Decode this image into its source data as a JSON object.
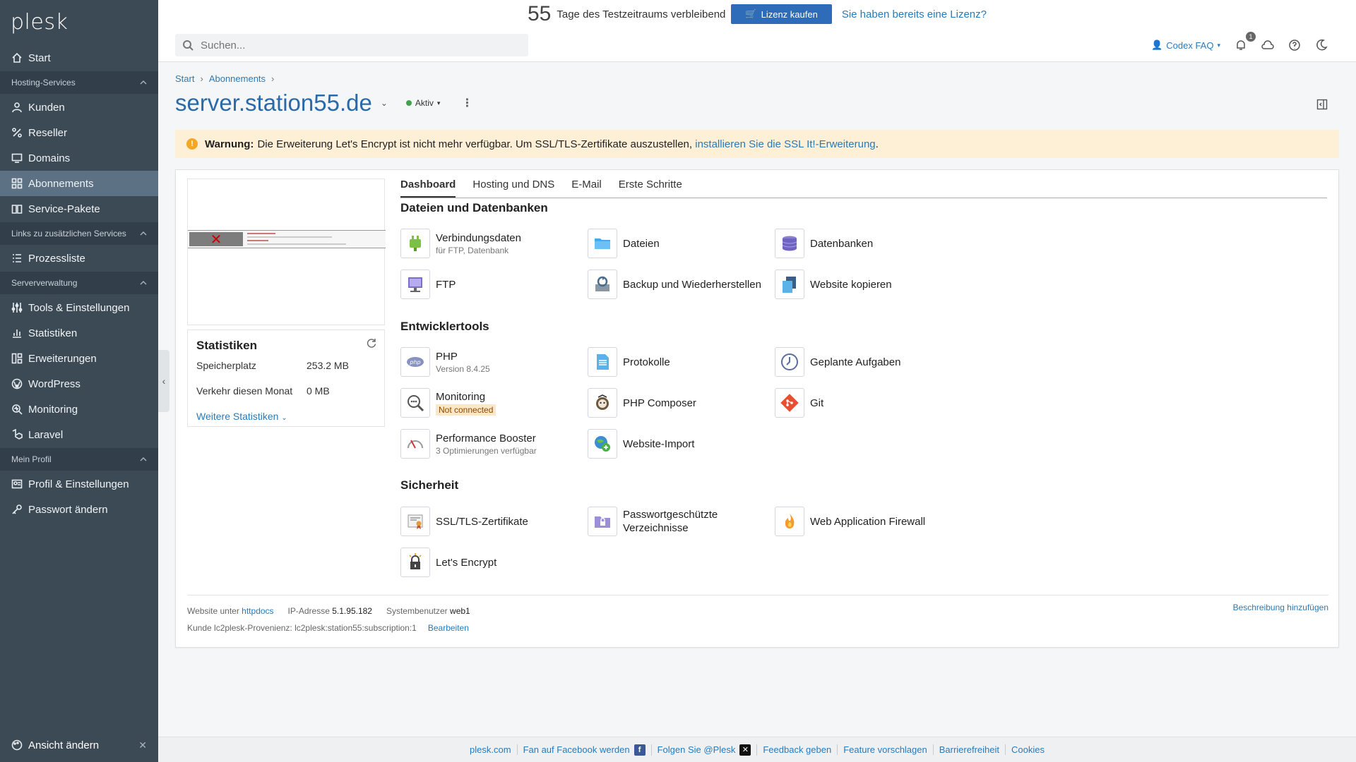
{
  "sidebar": {
    "logo": "plesk",
    "start": "Start",
    "group_hosting": "Hosting-Services",
    "kunden": "Kunden",
    "reseller": "Reseller",
    "domains": "Domains",
    "abonnements": "Abonnements",
    "service_pakete": "Service-Pakete",
    "group_links": "Links zu zusätzlichen Services",
    "prozessliste": "Prozessliste",
    "group_server": "Serververwaltung",
    "tools": "Tools & Einstellungen",
    "statistiken": "Statistiken",
    "erweiterungen": "Erweiterungen",
    "wordpress": "WordPress",
    "monitoring": "Monitoring",
    "laravel": "Laravel",
    "group_profil": "Mein Profil",
    "profil": "Profil & Einstellungen",
    "passwort": "Passwort ändern",
    "ansicht": "Ansicht ändern"
  },
  "trial": {
    "count": "55",
    "text": "Tage des Testzeitraums verbleibend",
    "buy": "Lizenz kaufen",
    "have": "Sie haben bereits eine Lizenz?"
  },
  "header": {
    "search_placeholder": "Suchen...",
    "user": "Codex FAQ",
    "notifications": "1"
  },
  "breadcrumb": {
    "start": "Start",
    "abonnements": "Abonnements"
  },
  "page": {
    "title": "server.station55.de",
    "status": "Aktiv"
  },
  "warning": {
    "label": "Warnung:",
    "text": "Die Erweiterung Let's Encrypt ist nicht mehr verfügbar. Um SSL/TLS-Zertifikate auszustellen,",
    "link": "installieren Sie die SSL It!-Erweiterung",
    "end": "."
  },
  "stats": {
    "title": "Statistiken",
    "disk_label": "Speicherplatz",
    "disk_value": "253.2 MB",
    "traffic_label": "Verkehr diesen Monat",
    "traffic_value": "0 MB",
    "more": "Weitere Statistiken"
  },
  "tabs": [
    "Dashboard",
    "Hosting und DNS",
    "E-Mail",
    "Erste Schritte"
  ],
  "sections": {
    "files": "Dateien und Datenbanken",
    "dev": "Entwicklertools",
    "security": "Sicherheit"
  },
  "tiles": {
    "verbindung": "Verbindungsdaten",
    "verbindung_sub": "für FTP, Datenbank",
    "dateien": "Dateien",
    "datenbanken": "Datenbanken",
    "ftp": "FTP",
    "backup": "Backup und Wiederherstellen",
    "kopieren": "Website kopieren",
    "php": "PHP",
    "php_sub": "Version 8.4.25",
    "protokolle": "Protokolle",
    "geplant": "Geplante Aufgaben",
    "monitoring": "Monitoring",
    "monitoring_badge": "Not connected",
    "composer": "PHP Composer",
    "git": "Git",
    "booster": "Performance Booster",
    "booster_sub": "3 Optimierungen verfügbar",
    "import": "Website-Import",
    "ssl": "SSL/TLS-Zertifikate",
    "pw1": "Passwortgeschützte",
    "pw2": "Verzeichnisse",
    "waf": "Web Application Firewall",
    "letsencrypt": "Let's Encrypt"
  },
  "cardfooter": {
    "website_label": "Website unter",
    "website_link": "httpdocs",
    "ip_label": "IP-Adresse",
    "ip": "5.1.95.182",
    "user_label": "Systembenutzer",
    "user": "web1",
    "kunde": "Kunde lc2plesk-Provenienz: lc2plesk:station55:subscription:1",
    "edit": "Bearbeiten",
    "add_desc": "Beschreibung hinzufügen"
  },
  "footer": {
    "plesk": "plesk.com",
    "facebook": "Fan auf Facebook werden",
    "x": "Folgen Sie @Plesk",
    "feedback": "Feedback geben",
    "feature": "Feature vorschlagen",
    "access": "Barrierefreiheit",
    "cookies": "Cookies"
  },
  "colors": {
    "sidebar": "#3c4a56",
    "accent": "#2a7ab8",
    "warning_bg": "#fdf0d7"
  }
}
